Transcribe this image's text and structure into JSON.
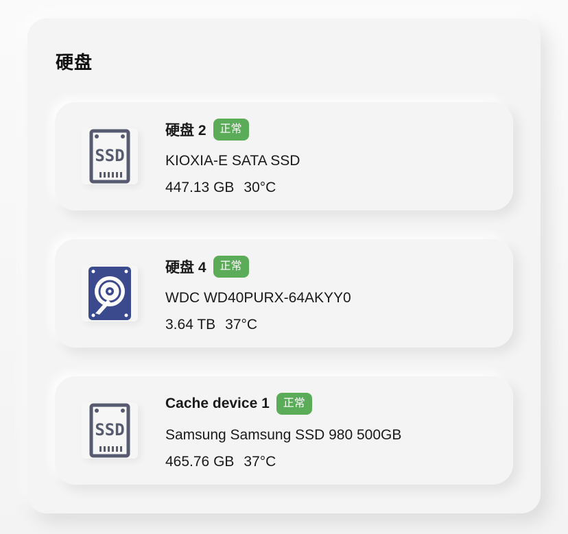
{
  "section": {
    "title": "硬盘"
  },
  "disks": [
    {
      "name": "硬盘 2",
      "status": "正常",
      "model": "KIOXIA-E SATA SSD",
      "capacity": "447.13 GB",
      "temperature": "30°C",
      "icon": "ssd-icon",
      "status_color": "#5bac58"
    },
    {
      "name": "硬盘 4",
      "status": "正常",
      "model": "WDC WD40PURX-64AKYY0",
      "capacity": "3.64 TB",
      "temperature": "37°C",
      "icon": "hdd-icon",
      "status_color": "#5bac58"
    },
    {
      "name": "Cache device 1",
      "status": "正常",
      "model": "Samsung Samsung SSD 980 500GB",
      "capacity": "465.76 GB",
      "temperature": "37°C",
      "icon": "ssd-icon",
      "status_color": "#5bac58"
    }
  ]
}
